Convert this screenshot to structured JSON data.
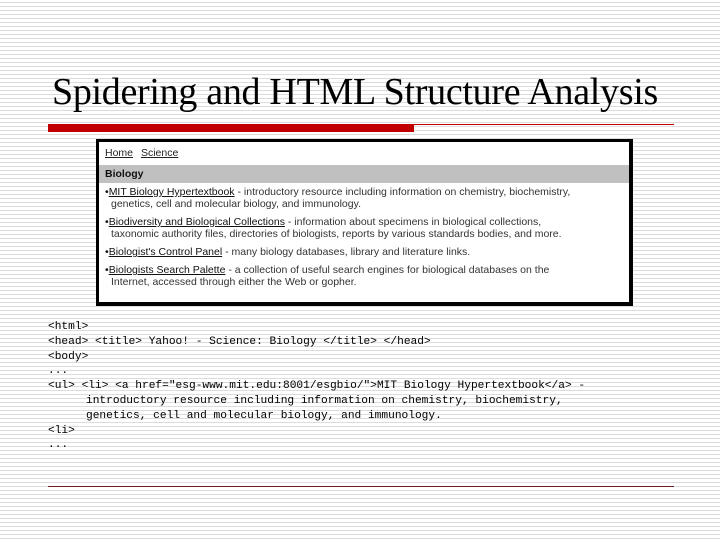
{
  "slide": {
    "title": "Spidering and HTML Structure Analysis",
    "accent_color": "#c00000"
  },
  "screenshot": {
    "breadcrumbs": [
      "Home",
      "Science"
    ],
    "category": "Biology",
    "entries": [
      {
        "link": "MIT Biology Hypertextbook",
        "desc": " - introductory resource including information on chemistry, biochemistry,",
        "desc2": "genetics, cell and molecular biology, and immunology."
      },
      {
        "link": "Biodiversity and Biological Collections",
        "desc": " - information about specimens in biological collections,",
        "desc2": "taxonomic authority files, directories of biologists, reports by various standards bodies, and more."
      },
      {
        "link": "Biologist's Control Panel",
        "desc": " - many biology databases, library and literature links.",
        "desc2": ""
      },
      {
        "link": "Biologists Search Palette",
        "desc": " - a collection of useful search engines for biological databases on the",
        "desc2": "Internet, accessed through either the Web or gopher."
      }
    ]
  },
  "code": {
    "lines": [
      "<html>",
      "<head> <title> Yahoo! - Science: Biology </title> </head>",
      "<body>",
      "...",
      "<ul> <li> <a href=\"esg-www.mit.edu:8001/esgbio/\">MIT Biology Hypertextbook</a> -",
      "introductory resource including information on chemistry, biochemistry,",
      "genetics, cell and molecular biology, and immunology.",
      "<li>",
      "..."
    ]
  }
}
